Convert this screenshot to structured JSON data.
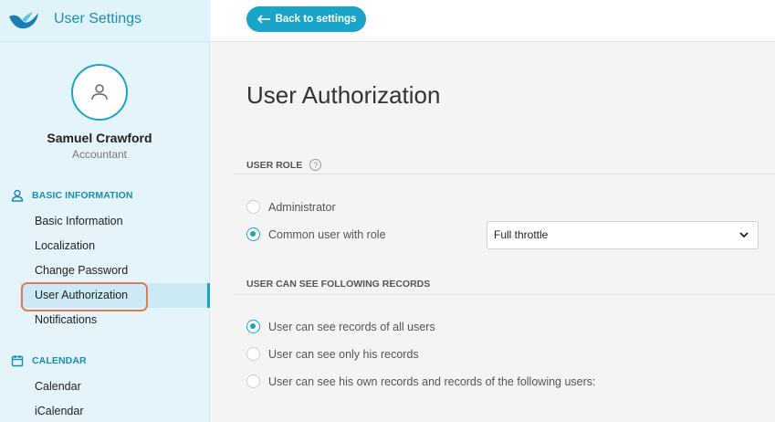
{
  "app": {
    "title": "User Settings"
  },
  "profile": {
    "name": "Samuel Crawford",
    "role": "Accountant",
    "avatar_icon": "user-icon"
  },
  "sidebar": {
    "sections": [
      {
        "title": "BASIC INFORMATION",
        "icon": "user-icon",
        "items": [
          {
            "label": "Basic Information"
          },
          {
            "label": "Localization"
          },
          {
            "label": "Change Password"
          },
          {
            "label": "User Authorization",
            "active": true
          },
          {
            "label": "Notifications"
          }
        ]
      },
      {
        "title": "CALENDAR",
        "icon": "calendar-icon",
        "items": [
          {
            "label": "Calendar"
          },
          {
            "label": "iCalendar"
          }
        ]
      }
    ]
  },
  "header": {
    "back_label": "Back to settings",
    "back_icon": "arrow-left-icon"
  },
  "main": {
    "title": "User Authorization",
    "user_role": {
      "heading": "USER ROLE",
      "options": [
        {
          "label": "Administrator",
          "checked": false
        },
        {
          "label": "Common user with role",
          "checked": true
        }
      ],
      "role_select": {
        "value": "Full throttle"
      }
    },
    "records": {
      "heading": "USER CAN SEE FOLLOWING RECORDS",
      "options": [
        {
          "label": "User can see records of all users",
          "checked": true
        },
        {
          "label": "User can see only his records",
          "checked": false
        },
        {
          "label": "User can see his own records and records of the following users:",
          "checked": false
        }
      ]
    }
  },
  "colors": {
    "accent": "#1aa5c8",
    "highlight_outline": "#e07b5a",
    "sidebar_bg": "#e5f4fa"
  }
}
